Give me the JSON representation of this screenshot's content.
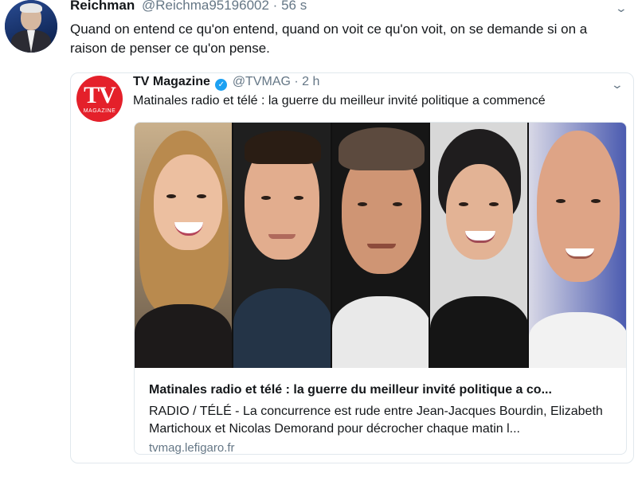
{
  "tweet": {
    "name": "Reichman",
    "handle": "@Reichma95196002 · 56 s",
    "text": "Quand on entend ce qu'on entend, quand on voit ce qu'on voit, on se demande si on a raison de penser ce qu'on pense."
  },
  "quoted": {
    "logo_text": "TV",
    "logo_sub": "MAGAZINE",
    "name": "TV Magazine",
    "handle": "@TVMAG · 2 h",
    "text": "Matinales radio et télé : la guerre du meilleur invité politique a commencé",
    "card": {
      "title": "Matinales radio et télé : la guerre du meilleur invité politique a co...",
      "description": "RADIO / TÉLÉ - La concurrence est rude entre Jean-Jacques Bourdin, Elizabeth Martichoux et Nicolas Demorand pour décrocher chaque matin l...",
      "domain": "tvmag.lefigaro.fr"
    }
  },
  "icons": {
    "menu": "chevron-down-icon",
    "verified": "verified-badge-icon"
  },
  "colors": {
    "accent": "#1da1f2",
    "logo": "#e4202a",
    "muted": "#657786",
    "border": "#e1e8ed"
  }
}
